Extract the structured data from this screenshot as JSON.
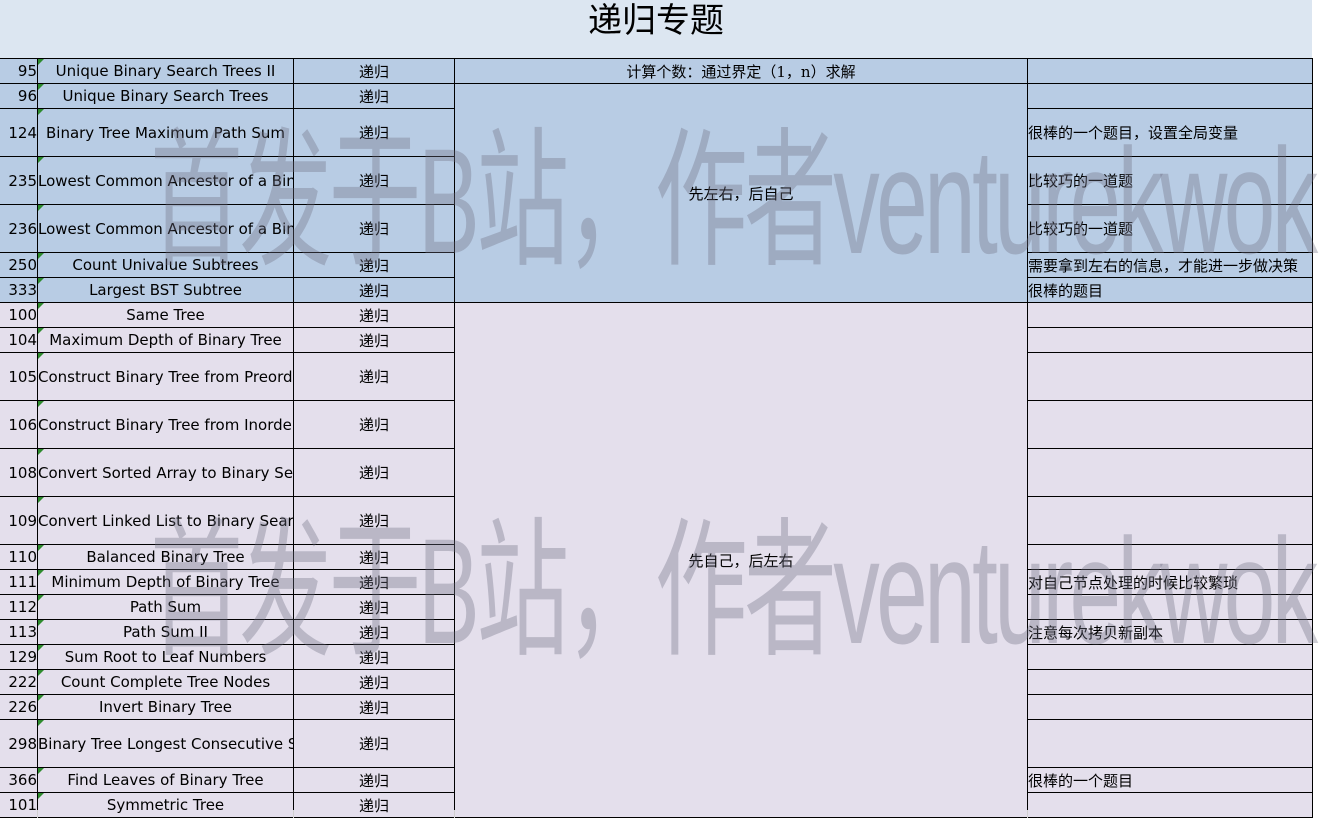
{
  "title": "递归专题",
  "tag_label": "递归",
  "groups": {
    "count": "计算个数：通过界定（1，n）求解",
    "left_right_self": "先左右，后自己",
    "self_left_right": "先自己，后左右"
  },
  "rows": [
    {
      "num": "95",
      "name": "Unique Binary Search Trees II",
      "note": ""
    },
    {
      "num": "96",
      "name": "Unique Binary Search Trees",
      "note": ""
    },
    {
      "num": "124",
      "name": "Binary Tree Maximum Path Sum",
      "note": "很棒的一个题目，设置全局变量"
    },
    {
      "num": "235",
      "name": "Lowest Common Ancestor of a Binary Search Tree",
      "note": "比较巧的一道题"
    },
    {
      "num": "236",
      "name": "Lowest Common Ancestor of a Binary Tree",
      "note": "比较巧的一道题"
    },
    {
      "num": "250",
      "name": "Count Univalue Subtrees",
      "note": "需要拿到左右的信息，才能进一步做决策"
    },
    {
      "num": "333",
      "name": "Largest BST Subtree",
      "note": "很棒的题目"
    },
    {
      "num": "100",
      "name": "Same Tree",
      "note": ""
    },
    {
      "num": "104",
      "name": "Maximum Depth of Binary Tree",
      "note": ""
    },
    {
      "num": "105",
      "name": "Construct Binary Tree from Preorder and Inorder Traversal",
      "note": ""
    },
    {
      "num": "106",
      "name": "Construct Binary Tree from Inorder and Postorder Traversal",
      "note": ""
    },
    {
      "num": "108",
      "name": "Convert Sorted Array to Binary Search Tree",
      "note": ""
    },
    {
      "num": "109",
      "name": "Convert Linked List to Binary Search Tree",
      "note": ""
    },
    {
      "num": "110",
      "name": "Balanced Binary Tree",
      "note": ""
    },
    {
      "num": "111",
      "name": "Minimum Depth of Binary Tree",
      "note": "对自己节点处理的时候比较繁琐"
    },
    {
      "num": "112",
      "name": "Path Sum",
      "note": ""
    },
    {
      "num": "113",
      "name": "Path Sum II",
      "note": "注意每次拷贝新副本"
    },
    {
      "num": "129",
      "name": "Sum Root to Leaf Numbers",
      "note": ""
    },
    {
      "num": "222",
      "name": "Count Complete Tree Nodes",
      "note": ""
    },
    {
      "num": "226",
      "name": "Invert Binary Tree",
      "note": ""
    },
    {
      "num": "298",
      "name": "Binary Tree Longest Consecutive Sequence",
      "note": ""
    },
    {
      "num": "366",
      "name": "Find Leaves of Binary Tree",
      "note": "很棒的一个题目"
    },
    {
      "num": "101",
      "name": "Symmetric Tree",
      "note": ""
    }
  ],
  "watermark": "首发于B站，作者venturekwok",
  "colors": {
    "title_band": "#dce6f1",
    "group_blue": "#b8cce4",
    "group_lavender": "#e4dfec"
  }
}
